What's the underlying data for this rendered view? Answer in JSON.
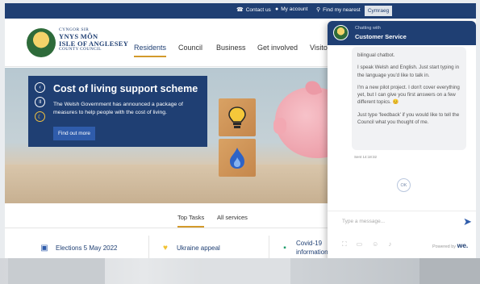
{
  "topbar": {
    "contact": "Contact us",
    "account": "My account",
    "nearest": "Find my nearest",
    "language": "Cymraeg"
  },
  "logo": {
    "line1": "CYNGOR SIR",
    "line2": "YNYS MÔN",
    "line3": "ISLE OF ANGLESEY",
    "line4": "COUNTY COUNCIL"
  },
  "nav": {
    "items": [
      "Residents",
      "Council",
      "Business",
      "Get involved",
      "Visito"
    ]
  },
  "hero": {
    "title": "Cost of living support scheme",
    "text": "The Welsh Government has announced a package of measures to help people with the cost of living.",
    "cta": "Find out more"
  },
  "tasks": {
    "tabs": [
      "Top Tasks",
      "All services"
    ],
    "cards": [
      "Elections 5 May 2022",
      "Ukraine appeal",
      "Covid-19 information"
    ]
  },
  "chat": {
    "header_small": "Chatting with",
    "header_title": "Customer Service",
    "messages": [
      "bilingual chatbot.",
      "I speak Welsh and English. Just start typing in the language you'd like to talk in.",
      "I'm a new pilot project. I don't cover everything yet, but I can give you first answers on a few different topics. 😊",
      "Just type 'feedback' if you would like to tell the Council what you thought of me."
    ],
    "sent": "Sent 14:18:32",
    "ok": "OK",
    "input_placeholder": "Type a message...",
    "powered_by": "Powered by",
    "brand": "we."
  }
}
